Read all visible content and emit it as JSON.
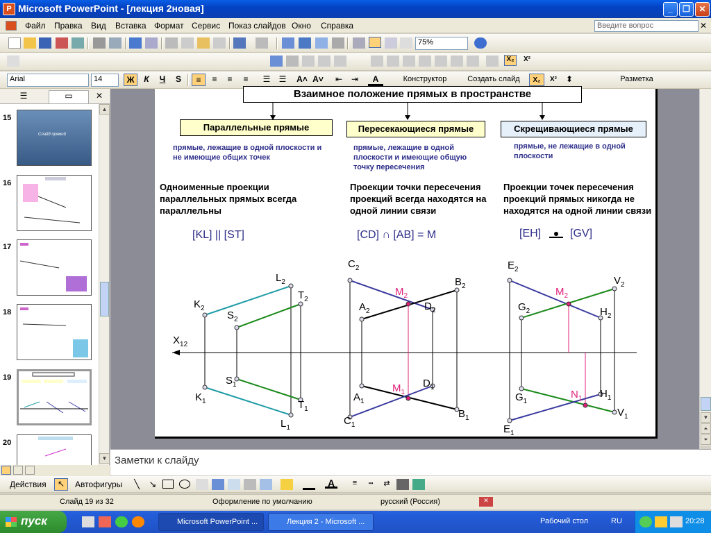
{
  "window": {
    "title": "Microsoft PowerPoint - [лекция 2новая]",
    "app_icon": "powerpoint-icon"
  },
  "menu": {
    "items": [
      "Файл",
      "Правка",
      "Вид",
      "Вставка",
      "Формат",
      "Сервис",
      "Показ слайдов",
      "Окно",
      "Справка"
    ],
    "ask_placeholder": "Введите вопрос"
  },
  "standard_toolbar": {
    "zoom": "75%"
  },
  "formatting_toolbar": {
    "font": "Arial",
    "size": "14",
    "bold": "Ж",
    "italic": "К",
    "underline": "Ч",
    "shadow": "S",
    "designer": "Конструктор",
    "new_slide": "Создать слайд",
    "layout": "Разметка"
  },
  "thumbnails": {
    "items": [
      {
        "num": "15",
        "caption": "Слайд прямой"
      },
      {
        "num": "16"
      },
      {
        "num": "17"
      },
      {
        "num": "18"
      },
      {
        "num": "19"
      },
      {
        "num": "20"
      }
    ]
  },
  "slide": {
    "title": "Взаимное положение прямых в пространстве",
    "columns": [
      {
        "header": "Параллельные прямые",
        "header_bg": "#ffffcc",
        "desc": "прямые, лежащие в одной плоскости и не имеющие общих точек",
        "text": "Одноименные проекции параллельных прямых всегда параллельны",
        "relation": "[KL] || [ST]"
      },
      {
        "header": "Пересекающиеся прямые",
        "header_bg": "#ffffcc",
        "desc": "прямые, лежащие в одной плоскости и имеющие общую точку пересечения",
        "text": "Проекции точки пересечения проекций всегда находятся на одной линии связи",
        "relation": "[CD] ∩ [AB] = M"
      },
      {
        "header": "Скрещивающиеся прямые",
        "header_bg": "#e6f0fa",
        "desc": "прямые,  не лежащие  в  одной плоскости",
        "text": "Проекции точек пересечения проекций  прямых никогда не находятся на одной линии связи",
        "relation_left": "[EH]",
        "relation_right": "[GV]"
      }
    ],
    "labels": {
      "axis": "X",
      "axis_sub": "12",
      "L2": "L",
      "T2": "T",
      "K2": "K",
      "S2": "S",
      "S1": "S",
      "K1": "K",
      "T1": "T",
      "L1": "L",
      "C2": "C",
      "M2a": "M",
      "B2": "B",
      "A2": "A",
      "D2": "D",
      "M1": "M",
      "D1": "D",
      "A1": "A",
      "C1": "C",
      "B1": "B",
      "E2": "E",
      "M2b": "M",
      "V2": "V",
      "G2": "G",
      "H2": "H",
      "N1": "N",
      "H1": "H",
      "G1": "G",
      "V1": "V",
      "E1": "E",
      "sub1": "1",
      "sub2": "2"
    },
    "colors": {
      "teal": "#1f9ca6",
      "green": "#1b8a1b",
      "navy": "#3a3aa0",
      "black": "#000000",
      "magenta": "#e0207a"
    }
  },
  "notes": {
    "placeholder": "Заметки к слайду"
  },
  "drawing": {
    "actions": "Действия",
    "autoshapes": "Автофигуры"
  },
  "status": {
    "slide": "Слайд 19 из 32",
    "design": "Оформление по умолчанию",
    "lang": "русский (Россия)"
  },
  "taskbar": {
    "start": "пуск",
    "tasks": [
      "Microsoft PowerPoint ...",
      "Лекция 2 - Microsoft ..."
    ],
    "desktop": "Рабочий стол",
    "lang": "RU",
    "time": "20:28"
  }
}
